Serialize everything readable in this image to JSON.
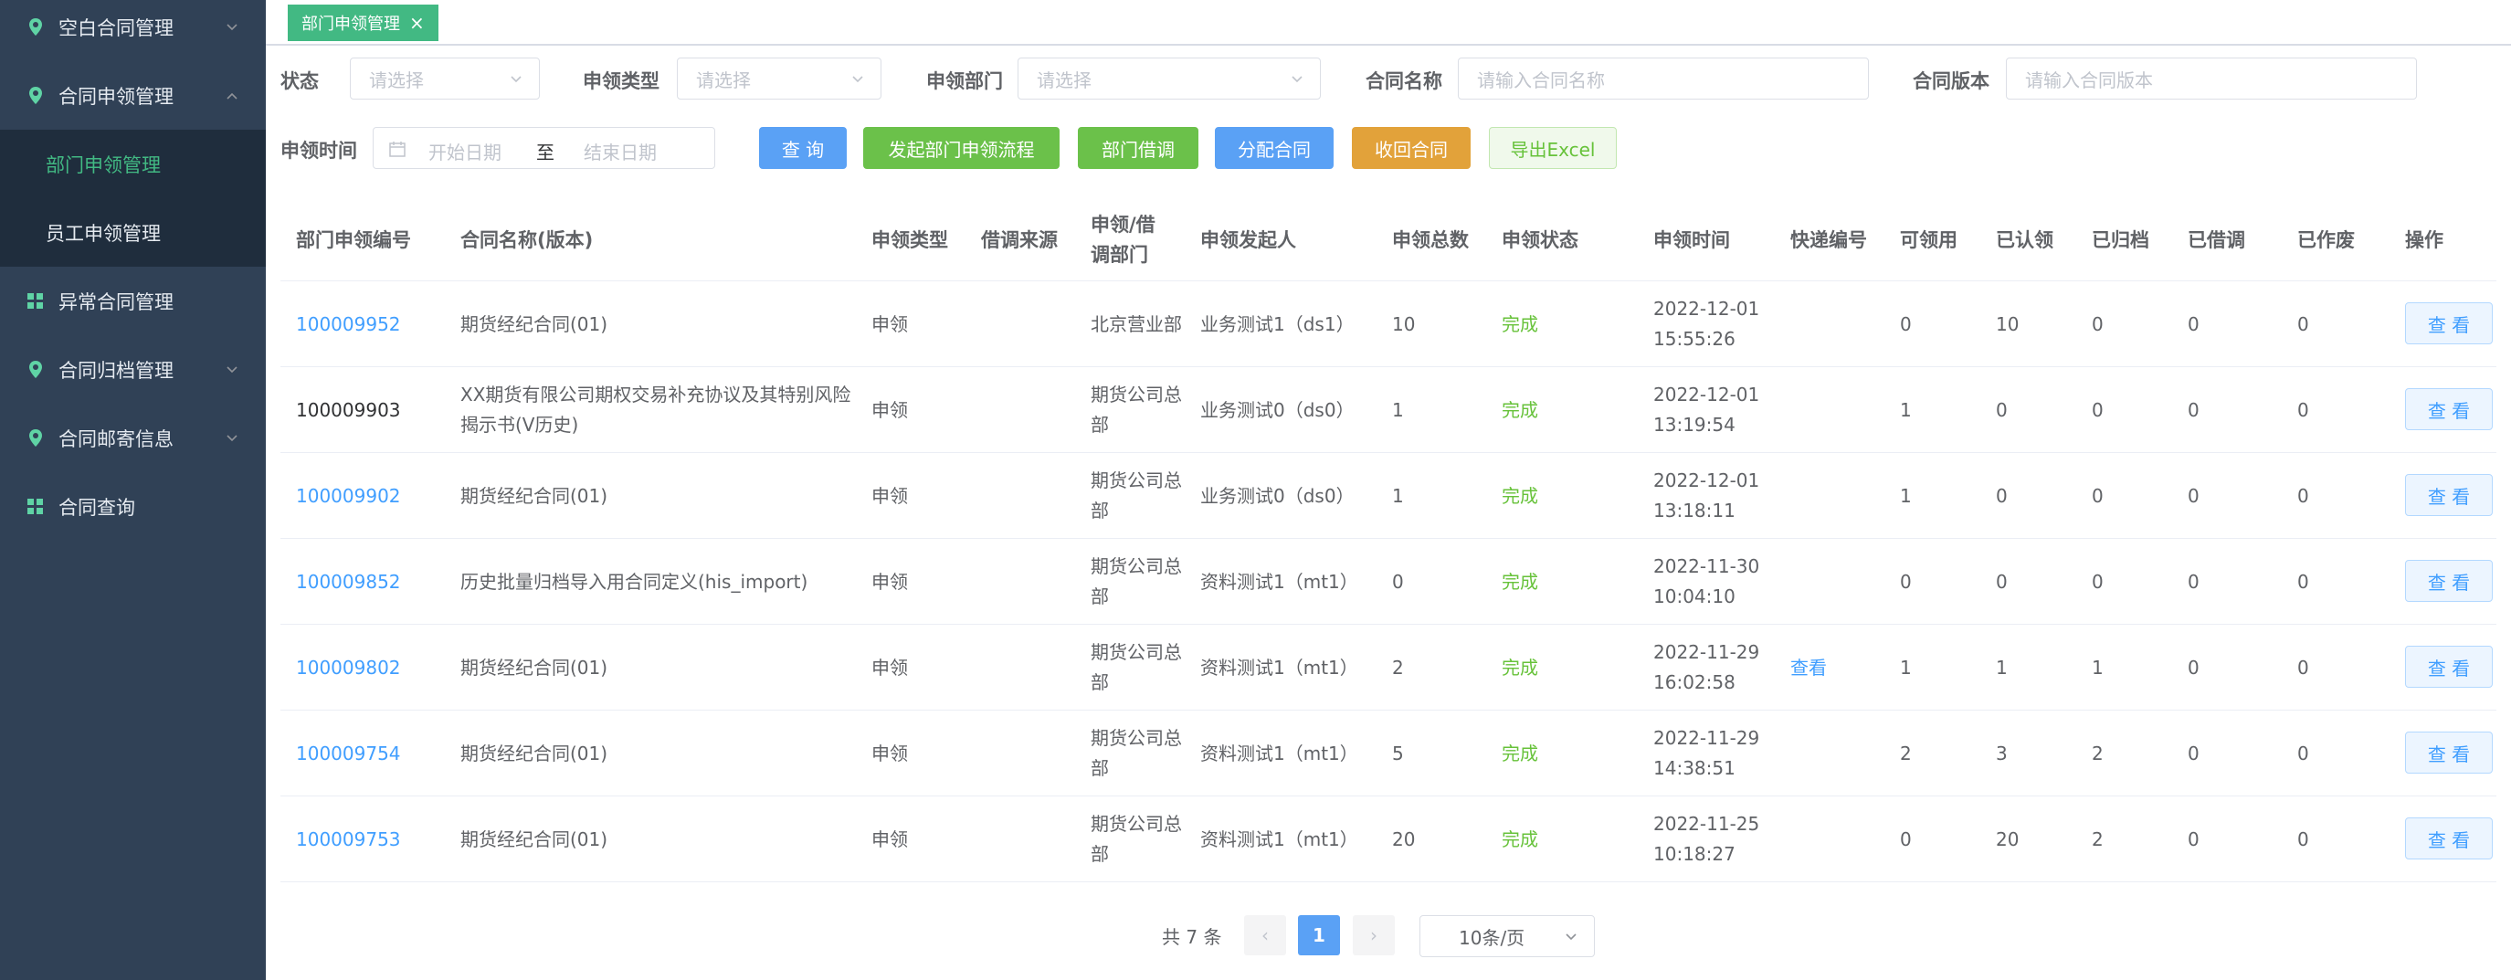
{
  "sidebar": {
    "items": [
      {
        "label": "空白合同管理",
        "icon": "location-pin-icon",
        "arrow": "chevron-down"
      },
      {
        "label": "合同申领管理",
        "icon": "location-pin-icon",
        "arrow": "chevron-up"
      },
      {
        "label": "异常合同管理",
        "icon": "grid-icon",
        "arrow": ""
      },
      {
        "label": "合同归档管理",
        "icon": "location-pin-icon",
        "arrow": "chevron-down"
      },
      {
        "label": "合同邮寄信息",
        "icon": "location-pin-icon",
        "arrow": "chevron-down"
      },
      {
        "label": "合同查询",
        "icon": "grid-icon",
        "arrow": ""
      }
    ],
    "sub_items": [
      {
        "label": "部门申领管理",
        "active": true
      },
      {
        "label": "员工申领管理",
        "active": false
      }
    ]
  },
  "tabs": [
    {
      "label": "部门申领管理",
      "close": "×"
    }
  ],
  "filters": {
    "status_label": "状态",
    "status_placeholder": "请选择",
    "type_label": "申领类型",
    "type_placeholder": "请选择",
    "dept_label": "申领部门",
    "dept_placeholder": "请选择",
    "name_label": "合同名称",
    "name_placeholder": "请输入合同名称",
    "version_label": "合同版本",
    "version_placeholder": "请输入合同版本",
    "time_label": "申领时间",
    "date_start": "开始日期",
    "date_sep": "至",
    "date_end": "结束日期"
  },
  "buttons": {
    "query": "查 询",
    "start_flow": "发起部门申领流程",
    "dept_transfer": "部门借调",
    "assign": "分配合同",
    "recall": "收回合同",
    "export": "导出Excel"
  },
  "table": {
    "headers": [
      "部门申领编号",
      "合同名称(版本)",
      "申领类型",
      "借调来源",
      "申领/借调部门",
      "申领发起人",
      "申领总数",
      "申领状态",
      "申领时间",
      "快递编号",
      "可领用",
      "已认领",
      "已归档",
      "已借调",
      "已作废",
      "操作"
    ],
    "rows": [
      {
        "id": "100009952",
        "id_link": true,
        "name": "期货经纪合同(01)",
        "type": "申领",
        "source": "",
        "dept": "北京营业部",
        "initiator": "业务测试1（ds1）",
        "total": "10",
        "status": "完成",
        "time": "2022-12-01 15:55:26",
        "express": "",
        "available": "0",
        "claimed": "10",
        "archived": "0",
        "transferred": "0",
        "voided": "0",
        "action": "查 看"
      },
      {
        "id": "100009903",
        "id_link": false,
        "name": "XX期货有限公司期权交易补充协议及其特别风险揭示书(V历史)",
        "type": "申领",
        "source": "",
        "dept": "期货公司总部",
        "initiator": "业务测试0（ds0）",
        "total": "1",
        "status": "完成",
        "time": "2022-12-01 13:19:54",
        "express": "",
        "available": "1",
        "claimed": "0",
        "archived": "0",
        "transferred": "0",
        "voided": "0",
        "action": "查 看"
      },
      {
        "id": "100009902",
        "id_link": true,
        "name": "期货经纪合同(01)",
        "type": "申领",
        "source": "",
        "dept": "期货公司总部",
        "initiator": "业务测试0（ds0）",
        "total": "1",
        "status": "完成",
        "time": "2022-12-01 13:18:11",
        "express": "",
        "available": "1",
        "claimed": "0",
        "archived": "0",
        "transferred": "0",
        "voided": "0",
        "action": "查 看"
      },
      {
        "id": "100009852",
        "id_link": true,
        "name": "历史批量归档导入用合同定义(his_import)",
        "type": "申领",
        "source": "",
        "dept": "期货公司总部",
        "initiator": "资料测试1（mt1）",
        "total": "0",
        "status": "完成",
        "time": "2022-11-30 10:04:10",
        "express": "",
        "available": "0",
        "claimed": "0",
        "archived": "0",
        "transferred": "0",
        "voided": "0",
        "action": "查 看"
      },
      {
        "id": "100009802",
        "id_link": true,
        "name": "期货经纪合同(01)",
        "type": "申领",
        "source": "",
        "dept": "期货公司总部",
        "initiator": "资料测试1（mt1）",
        "total": "2",
        "status": "完成",
        "time": "2022-11-29 16:02:58",
        "express": "查看",
        "available": "1",
        "claimed": "1",
        "archived": "1",
        "transferred": "0",
        "voided": "0",
        "action": "查 看"
      },
      {
        "id": "100009754",
        "id_link": true,
        "name": "期货经纪合同(01)",
        "type": "申领",
        "source": "",
        "dept": "期货公司总部",
        "initiator": "资料测试1（mt1）",
        "total": "5",
        "status": "完成",
        "time": "2022-11-29 14:38:51",
        "express": "",
        "available": "2",
        "claimed": "3",
        "archived": "2",
        "transferred": "0",
        "voided": "0",
        "action": "查 看"
      },
      {
        "id": "100009753",
        "id_link": true,
        "name": "期货经纪合同(01)",
        "type": "申领",
        "source": "",
        "dept": "期货公司总部",
        "initiator": "资料测试1（mt1）",
        "total": "20",
        "status": "完成",
        "time": "2022-11-25 10:18:27",
        "express": "",
        "available": "0",
        "claimed": "20",
        "archived": "2",
        "transferred": "0",
        "voided": "0",
        "action": "查 看"
      }
    ]
  },
  "pagination": {
    "total_text": "共 7 条",
    "prev": "‹",
    "current": "1",
    "next": "›",
    "page_size": "10条/页"
  },
  "colors": {
    "sidebar_bg": "#304156",
    "submenu_bg": "#1f2d3d",
    "active_sub": "#42b983",
    "primary": "#5aa1f5",
    "success": "#6bc14a",
    "warning": "#e2a23a",
    "link": "#409eff"
  }
}
